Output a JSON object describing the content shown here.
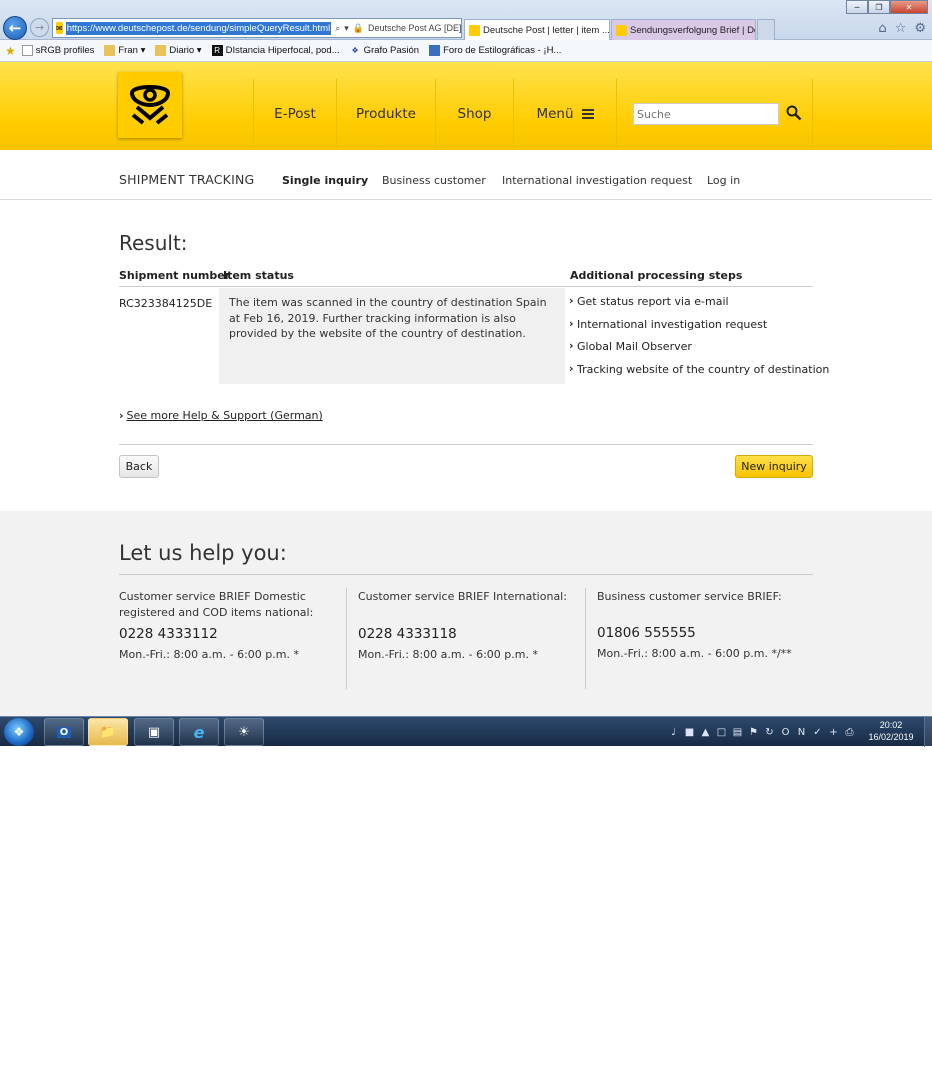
{
  "browser": {
    "url": "https://www.deutschepost.de/sendung/simpleQueryResult.html",
    "site_identity": "Deutsche Post AG [DE]",
    "tabs": [
      {
        "label": "Deutsche Post | letter | item ...",
        "active": true
      },
      {
        "label": "Sendungsverfolgung Brief | De...",
        "active": false
      }
    ],
    "favorites": [
      {
        "label": "sRGB profiles"
      },
      {
        "label": "Fran",
        "dropdown": true
      },
      {
        "label": "Diario",
        "dropdown": true
      },
      {
        "label": "DIstancia Hiperfocal, pod..."
      },
      {
        "label": "Grafo Pasión"
      },
      {
        "label": "Foro de Estilográficas - ¡H..."
      }
    ]
  },
  "header": {
    "nav": [
      "E-Post",
      "Produkte",
      "Shop",
      "Menü"
    ],
    "search_placeholder": "Suche",
    "brand_color": "#ffcc00"
  },
  "subnav": {
    "title": "SHIPMENT TRACKING",
    "links": [
      "Single inquiry",
      "Business customer",
      "International investigation request",
      "Log in"
    ],
    "active": "Single inquiry"
  },
  "result": {
    "title": "Result:",
    "headers": {
      "number": "Shipment number",
      "status": "Item status",
      "steps": "Additional processing steps"
    },
    "shipment_number": "RC323384125DE",
    "status_text": "The item was scanned in the country of destination Spain at Feb 16, 2019. Further tracking information is also provided by the website of the country of destination.",
    "steps": [
      "Get status report via e-mail",
      "International investigation request",
      "Global Mail Observer",
      "Tracking website of the country of destination"
    ],
    "help_link": "See more Help & Support (German)",
    "back_button": "Back",
    "new_inquiry_button": "New inquiry"
  },
  "help": {
    "title": "Let us help you:",
    "columns": [
      {
        "label_line1": "Customer service BRIEF Domestic",
        "label_line2": "registered and COD items national:",
        "phone": "0228 4333112",
        "hours": "Mon.-Fri.: 8:00 a.m. - 6:00 p.m. *"
      },
      {
        "label_line1": "Customer service BRIEF International:",
        "label_line2": "",
        "phone": "0228 4333118",
        "hours": "Mon.-Fri.: 8:00 a.m. - 6:00 p.m. *"
      },
      {
        "label_line1": "Business customer service BRIEF:",
        "label_line2": "",
        "phone": "01806 555555",
        "hours": "Mon.-Fri.: 8:00 a.m. - 6:00 p.m. */**"
      }
    ]
  },
  "taskbar": {
    "time": "20:02",
    "date": "16/02/2019"
  }
}
